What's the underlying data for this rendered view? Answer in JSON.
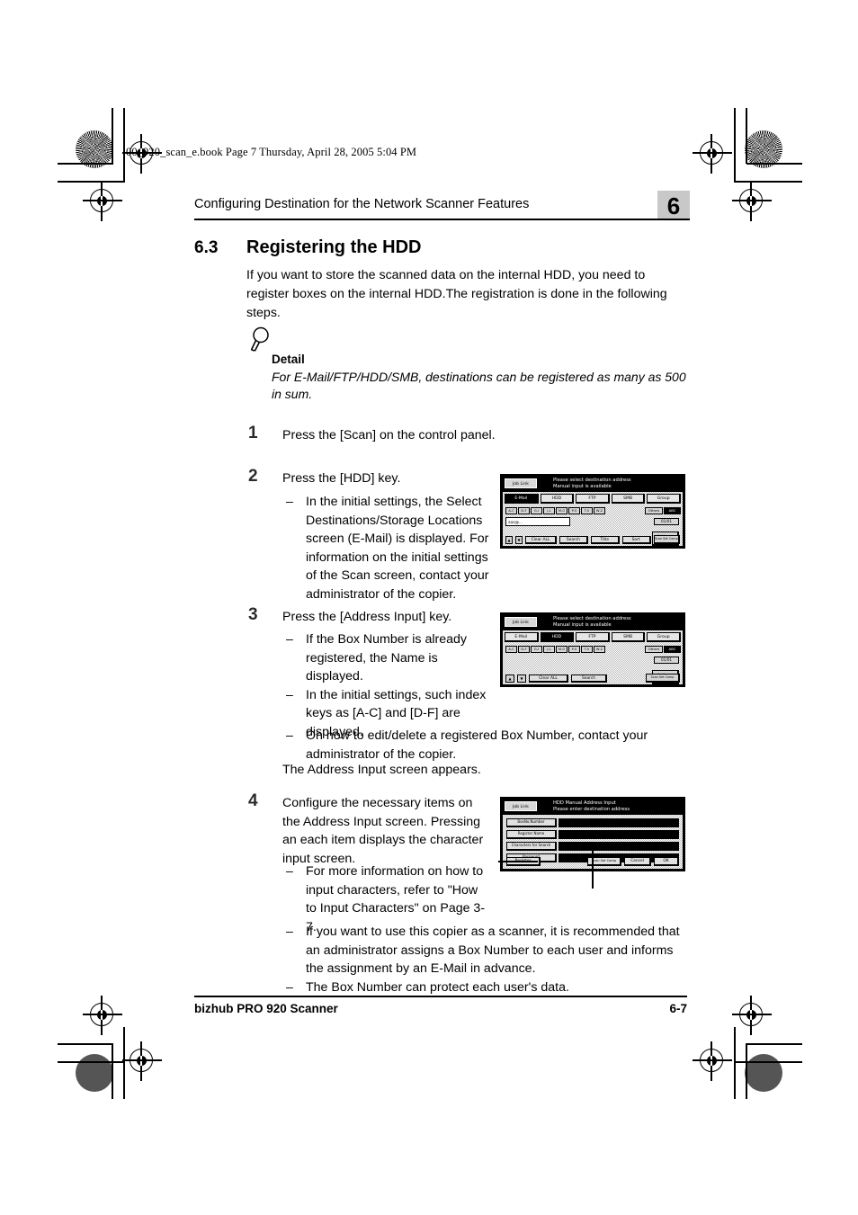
{
  "book_line": "00_920_scan_e.book  Page 7  Thursday, April 28, 2005  5:04 PM",
  "header": {
    "running_head": "Configuring Destination for the Network Scanner Features",
    "chapter_badge": "6"
  },
  "section": {
    "number": "6.3",
    "title": "Registering the HDD",
    "intro": "If you want to store the scanned data on the internal HDD, you need to register boxes on the internal HDD.The registration is done in the following steps."
  },
  "detail": {
    "icon": "magnifier-icon",
    "title": "Detail",
    "body": "For E-Mail/FTP/HDD/SMB, destinations can be registered as many as 500 in sum."
  },
  "steps": [
    {
      "number": "1",
      "text": "Press the [Scan] on the control panel.",
      "bullets": []
    },
    {
      "number": "2",
      "text": "Press the [HDD] key.",
      "bullets": [
        "In the initial settings, the Select Destinations/Storage Locations screen (E-Mail) is displayed. For information on the initial settings of the Scan screen, contact your administrator of the copier."
      ]
    },
    {
      "number": "3",
      "text": "Press the [Address Input] key.",
      "bullets": [
        "If the Box Number is already registered, the Name is displayed.",
        "In the initial settings, such index keys as [A-C] and [D-F] are displayed.",
        "On how to edit/delete a registered Box Number, contact your administrator of the copier."
      ],
      "closing": "The Address Input screen appears."
    },
    {
      "number": "4",
      "text": "Configure the necessary items on the Address Input screen. Pressing an each item displays the character input screen.",
      "bullets": [
        "For more information on how to input characters, refer to \"How to Input Characters\" on Page 3-7.",
        "If you want to use this copier as a scanner, it is recommended that an administrator assigns a Box Number to each user and informs the assignment by an E-Mail in advance.",
        "The Box Number can protect each user's data."
      ]
    }
  ],
  "panels": {
    "select_destination_email": {
      "job_link": "Job Link",
      "title_line1": "Please select destination address",
      "title_line2": "Manual input is available",
      "tabs": [
        {
          "label": "E-Mail",
          "selected": true
        },
        {
          "label": "HDD",
          "selected": false
        },
        {
          "label": "FTP",
          "selected": false
        },
        {
          "label": "SMB",
          "selected": false
        },
        {
          "label": "Group",
          "selected": false
        }
      ],
      "index_keys": [
        "A-C",
        "D-F",
        "G-I",
        "J-L",
        "M-O",
        "P-S",
        "T-V",
        "W-Z"
      ],
      "list_entries": [
        "aaa@..."
      ],
      "others_label": "Others",
      "others_selected_label": "ABC",
      "page_indicator": "01/01",
      "address_input_label": "Address Input",
      "bottom_buttons": [
        "Clear ALL",
        "Search",
        "Title",
        "Sort"
      ],
      "scan_complete_label": "Scan Set Comp",
      "arrow_up": "▲",
      "arrow_down": "▼"
    },
    "select_destination_hdd": {
      "job_link": "Job Link",
      "title_line1": "Please select destination address",
      "title_line2": "Manual input is available",
      "tabs": [
        {
          "label": "E-Mail",
          "selected": false
        },
        {
          "label": "HDD",
          "selected": true
        },
        {
          "label": "FTP",
          "selected": false
        },
        {
          "label": "SMB",
          "selected": false
        },
        {
          "label": "Group",
          "selected": false
        }
      ],
      "index_keys": [
        "A-C",
        "D-F",
        "G-I",
        "J-L",
        "M-O",
        "P-S",
        "T-V",
        "W-Z"
      ],
      "list_entries": [],
      "others_label": "Others",
      "others_selected_label": "ABC",
      "page_indicator": "01/01",
      "address_input_label": "Address Input",
      "bottom_buttons": [
        "Clear ALL",
        "Search"
      ],
      "scan_complete_label": "Scan Set Comp",
      "arrow_up": "▲",
      "arrow_down": "▼"
    },
    "hdd_manual_address_input": {
      "job_link": "Job Link",
      "title_line1": "HDD Manual Address Input",
      "title_line2": "Please enter destination address",
      "fields": [
        {
          "label": "BoxNo.Number",
          "value": ""
        },
        {
          "label": "Register Name",
          "value": ""
        },
        {
          "label": "Characters for Search",
          "value": ""
        },
        {
          "label": "Password",
          "value": ""
        }
      ],
      "register_label": "Register",
      "scan_complete_label": "Scan Set Comp",
      "cancel_label": "Cancel",
      "ok_label": "OK"
    }
  },
  "footer": {
    "left": "bizhub PRO 920 Scanner",
    "right": "6-7"
  }
}
